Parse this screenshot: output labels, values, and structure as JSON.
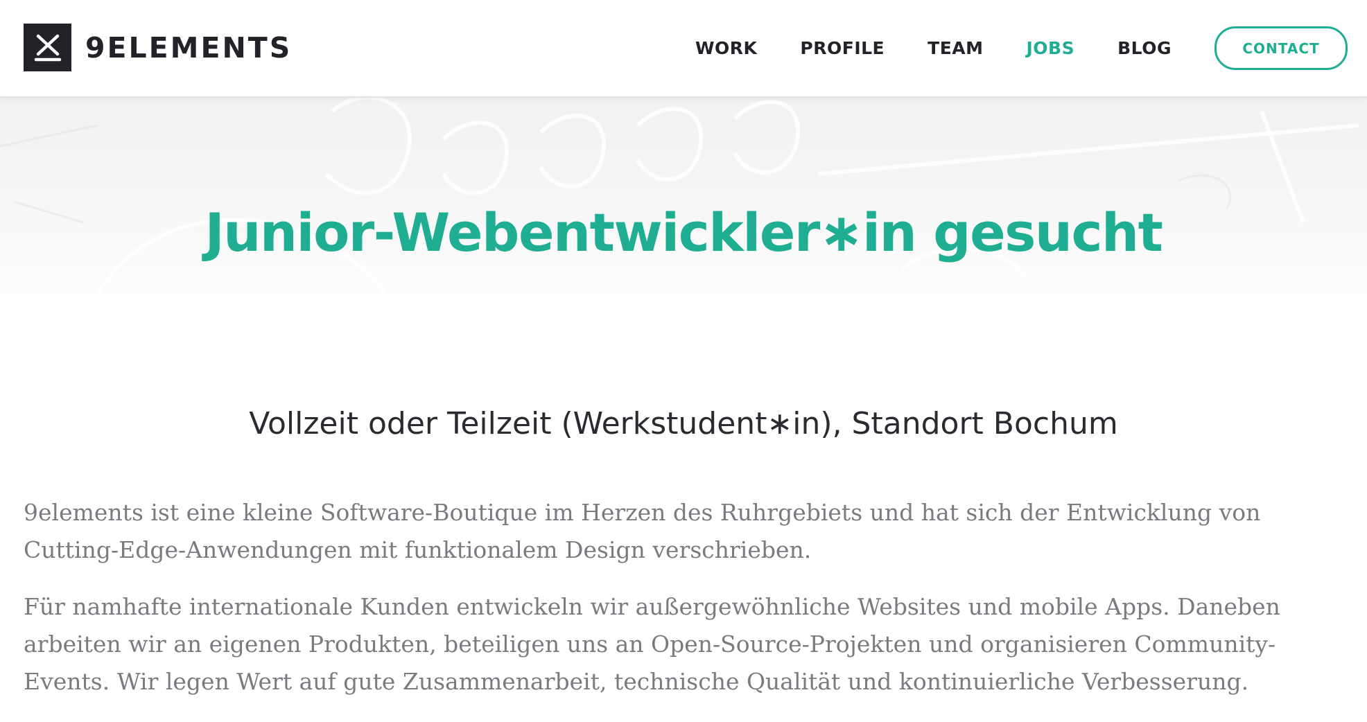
{
  "header": {
    "brand": "9ELEMENTS",
    "logo_icon": "x-logo-icon",
    "nav": [
      {
        "label": "WORK",
        "active": false
      },
      {
        "label": "PROFILE",
        "active": false
      },
      {
        "label": "TEAM",
        "active": false
      },
      {
        "label": "JOBS",
        "active": true
      },
      {
        "label": "BLOG",
        "active": false
      }
    ],
    "contact_label": "CONTACT"
  },
  "hero": {
    "title": "Junior-Webentwickler∗in gesucht"
  },
  "content": {
    "subtitle": "Vollzeit oder Teilzeit (Werkstudent∗in), Standort Bochum",
    "paragraphs": [
      "9elements ist eine kleine Software-Boutique im Herzen des Ruhrgebiets und hat sich der Entwicklung von Cutting-Edge-Anwendungen mit funktionalem Design verschrieben.",
      "Für namhafte internationale Kunden entwickeln wir außergewöhnliche Websites und mobile Apps. Daneben arbeiten wir an eigenen Produkten, beteiligen uns an Open-Source-Projekten und organisieren Community-Events. Wir legen Wert auf gute Zusammenarbeit, technische Qualität und kontinuierliche Verbesserung."
    ]
  },
  "colors": {
    "accent": "#1fae92",
    "dark": "#222228",
    "body_text": "#7a7a80"
  }
}
